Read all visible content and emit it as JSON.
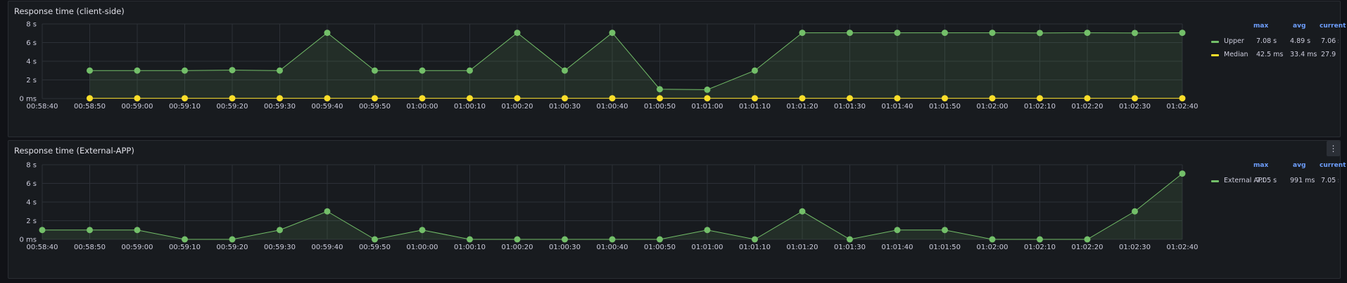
{
  "panels": [
    {
      "title": "Response time (client-side)",
      "legend": {
        "headers": [
          "max",
          "avg",
          "current"
        ],
        "rows": [
          {
            "name": "Upper",
            "color": "#73bf69",
            "max": "7.08 s",
            "avg": "4.89 s",
            "current": "7.06 s"
          },
          {
            "name": "Median",
            "color": "#fade2a",
            "max": "42.5 ms",
            "avg": "33.4 ms",
            "current": "27.9 ms"
          }
        ]
      }
    },
    {
      "title": "Response time (External-APP)",
      "menu_icon": "kebab-menu-icon",
      "legend": {
        "headers": [
          "max",
          "avg",
          "current"
        ],
        "rows": [
          {
            "name": "External API",
            "color": "#73bf69",
            "max": "7.05 s",
            "avg": "991 ms",
            "current": "7.05 s"
          }
        ]
      }
    }
  ],
  "chart_data": [
    {
      "type": "line",
      "title": "Response time (client-side)",
      "x": [
        "00:58:40",
        "00:58:50",
        "00:59:00",
        "00:59:10",
        "00:59:20",
        "00:59:30",
        "00:59:40",
        "00:59:50",
        "01:00:00",
        "01:00:10",
        "01:00:20",
        "01:00:30",
        "01:00:40",
        "01:00:50",
        "01:01:00",
        "01:01:10",
        "01:01:20",
        "01:01:30",
        "01:01:40",
        "01:01:50",
        "01:02:00",
        "01:02:10",
        "01:02:20",
        "01:02:30",
        "01:02:40"
      ],
      "y_ticks": [
        "0 ms",
        "2 s",
        "4 s",
        "6 s",
        "8 s"
      ],
      "ylim": [
        0,
        8
      ],
      "unit": "s",
      "grid": true,
      "legend_position": "right",
      "series": [
        {
          "name": "Upper",
          "color": "#73bf69",
          "fill": true,
          "values": [
            null,
            3,
            3,
            3,
            3.05,
            3,
            7.05,
            3,
            3,
            3,
            7.05,
            3,
            7.05,
            1,
            0.95,
            3,
            7.05,
            7.05,
            7.05,
            7.05,
            7.05,
            7.03,
            7.05,
            7.03,
            7.05
          ]
        },
        {
          "name": "Median",
          "color": "#fade2a",
          "fill": false,
          "values": [
            null,
            0.03,
            0.03,
            0.03,
            0.03,
            0.03,
            0.03,
            0.03,
            0.03,
            0.03,
            0.03,
            0.03,
            0.03,
            0.03,
            0.03,
            0.03,
            0.03,
            0.03,
            0.03,
            0.03,
            0.03,
            0.03,
            0.03,
            0.03,
            0.03
          ]
        }
      ]
    },
    {
      "type": "line",
      "title": "Response time (External-APP)",
      "x": [
        "00:58:40",
        "00:58:50",
        "00:59:00",
        "00:59:10",
        "00:59:20",
        "00:59:30",
        "00:59:40",
        "00:59:50",
        "01:00:00",
        "01:00:10",
        "01:00:20",
        "01:00:30",
        "01:00:40",
        "01:00:50",
        "01:01:00",
        "01:01:10",
        "01:01:20",
        "01:01:30",
        "01:01:40",
        "01:01:50",
        "01:02:00",
        "01:02:10",
        "01:02:20",
        "01:02:30",
        "01:02:40"
      ],
      "y_ticks": [
        "0 ms",
        "2 s",
        "4 s",
        "6 s",
        "8 s"
      ],
      "ylim": [
        0,
        8
      ],
      "unit": "s",
      "grid": true,
      "legend_position": "right",
      "series": [
        {
          "name": "External API",
          "color": "#73bf69",
          "fill": true,
          "values": [
            1,
            1,
            1,
            0,
            0,
            1,
            3,
            0,
            1,
            0,
            0,
            0,
            0,
            0,
            1,
            0,
            3,
            0,
            1,
            1,
            0,
            0,
            0,
            3,
            7.05
          ]
        }
      ]
    }
  ]
}
